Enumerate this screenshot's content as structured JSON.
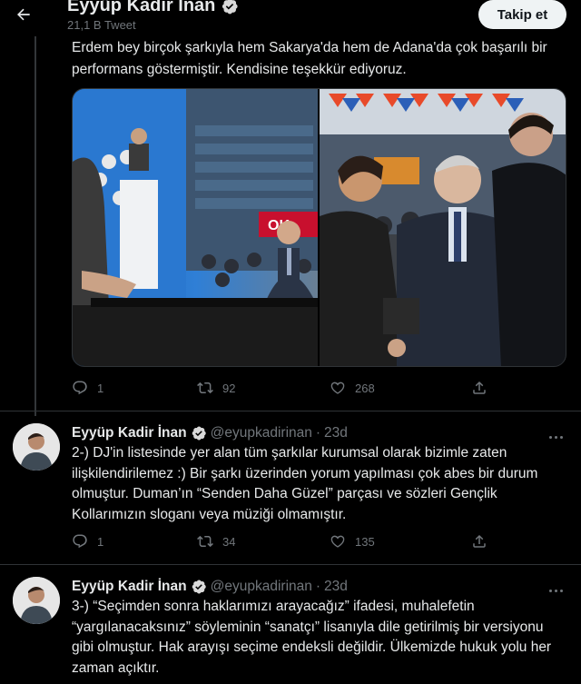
{
  "header": {
    "name": "Eyyüp Kadir İnan",
    "tweet_count": "21,1 B Tweet",
    "follow_label": "Takip et",
    "back_icon": "arrow-left-icon",
    "verified_icon": "verified-badge-icon"
  },
  "main_tweet": {
    "text": "Erdem bey birçok şarkıyla hem Sakarya'da hem de  Adana'da çok başarılı bir performans göstermiştir. Kendisine teşekkür ediyoruz.",
    "media": [
      {
        "icon": "photo-stage-speech"
      },
      {
        "icon": "photo-handshake-crowd"
      }
    ],
    "stats": {
      "replies": "1",
      "retweets": "92",
      "likes": "268"
    }
  },
  "replies": [
    {
      "name": "Eyyüp Kadir İnan",
      "handle": "@eyupkadirinan",
      "separator": "·",
      "time": "23d",
      "text": "2-) DJ'in listesinde yer alan tüm şarkılar kurumsal olarak bizimle zaten ilişkilendirilemez :)  Bir şarkı üzerinden yorum yapılması çok abes bir durum olmuştur. Duman’ın “Senden Daha Güzel” parçası ve sözleri Gençlik Kollarımızın sloganı veya müziği olmamıştır.",
      "stats": {
        "replies": "1",
        "retweets": "34",
        "likes": "135"
      }
    },
    {
      "name": "Eyyüp Kadir İnan",
      "handle": "@eyupkadirinan",
      "separator": "·",
      "time": "23d",
      "text": "3-) “Seçimden sonra haklarımızı arayacağız” ifadesi, muhalefetin “yargılanacaksınız” söyleminin “sanatçı” lisanıyla dile getirilmiş bir versiyonu gibi olmuştur. Hak arayışı seçime endeksli değildir. Ülkemizde hukuk yolu her zaman açıktır."
    }
  ],
  "colors": {
    "background": "#000000",
    "text": "#e7e9ea",
    "secondary": "#71767b",
    "border": "#2f3336",
    "verified": "#d9d9d9",
    "follow_bg": "#eff3f4"
  }
}
